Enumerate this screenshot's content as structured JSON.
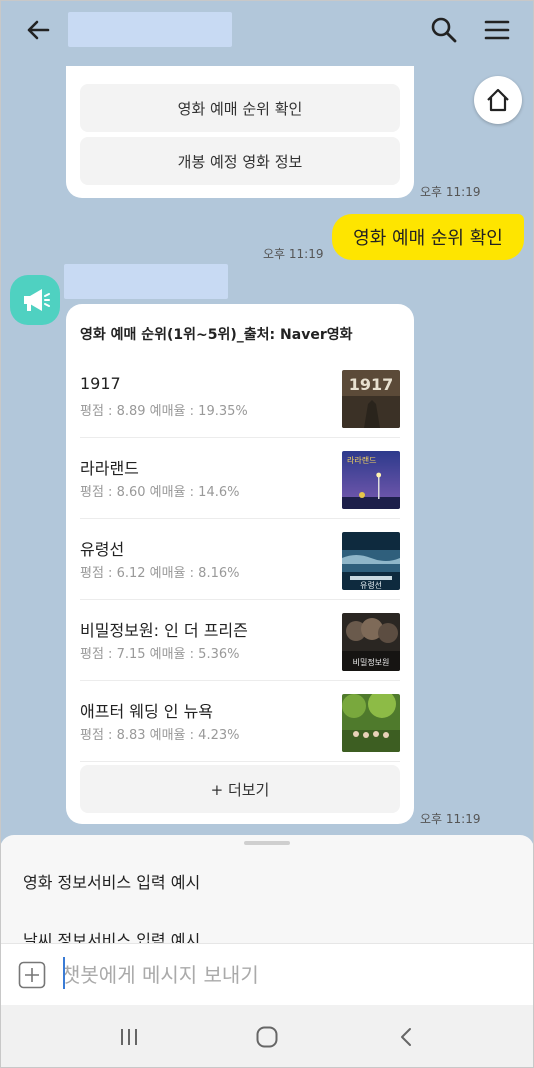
{
  "quick_replies": {
    "items": [
      {
        "label": "영화 예매 순위 확인"
      },
      {
        "label": "개봉 예정 영화 정보"
      }
    ],
    "time": "오후 11:19"
  },
  "user_message": {
    "text": "영화 예매 순위 확인",
    "time": "오후 11:19"
  },
  "bot_card": {
    "title": "영화 예매 순위(1위~5위)_출처: Naver영화",
    "movies": [
      {
        "title": "1917",
        "meta": "평점 : 8.89   예매율 : 19.35%",
        "poster_text": "1917"
      },
      {
        "title": "라라랜드",
        "meta": "평점 : 8.60   예매율 : 14.6%",
        "poster_text": "라라랜드"
      },
      {
        "title": "유령선",
        "meta": "평점 : 6.12   예매율 : 8.16%",
        "poster_text": "유령선"
      },
      {
        "title": "비밀정보원: 인 더 프리즌",
        "meta": "평점 : 7.15   예매율 : 5.36%",
        "poster_text": "비밀정보원"
      },
      {
        "title": "애프터 웨딩 인 뉴욕",
        "meta": "평점 : 8.83   예매율 : 4.23%",
        "poster_text": ""
      }
    ],
    "more_label": "+ 더보기",
    "time": "오후 11:19"
  },
  "sheet": {
    "items": [
      {
        "label": "영화 정보서비스 입력 예시"
      },
      {
        "label": "날씨 정보서비스 입력 예시"
      }
    ]
  },
  "input": {
    "placeholder": "챗봇에게 메시지 보내기"
  },
  "colors": {
    "chat_bg": "#b2c7da",
    "my_bubble": "#fee500",
    "bot_avatar": "#4fd1c1"
  }
}
